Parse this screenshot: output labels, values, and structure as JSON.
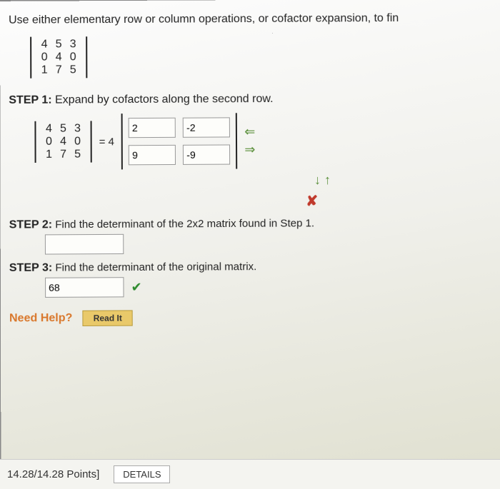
{
  "prompt": "Use either elementary row or column operations, or cofactor expansion, to fin",
  "matrix": {
    "r1": [
      "4",
      "5",
      "3"
    ],
    "r2": [
      "0",
      "4",
      "0"
    ],
    "r3": [
      "1",
      "7",
      "5"
    ]
  },
  "step1": {
    "label": "STEP 1:",
    "text": "Expand by cofactors along the second row.",
    "eq_coeff": "= 4",
    "box_tl": "2",
    "box_tr": "-2",
    "box_bl": "9",
    "box_br": "-9"
  },
  "feedback": {
    "cross": "✘",
    "down_up": "↓ ↑",
    "left": "⇐",
    "right": "⇒"
  },
  "step2": {
    "label": "STEP 2:",
    "text": "Find the determinant of the 2x2 matrix found in Step 1.",
    "value": ""
  },
  "step3": {
    "label": "STEP 3:",
    "text": "Find the determinant of the original matrix.",
    "value": "68",
    "check": "✔"
  },
  "help": {
    "label": "Need Help?",
    "read": "Read It"
  },
  "footer": {
    "points": "14.28/14.28 Points]",
    "details": "DETAILS"
  }
}
